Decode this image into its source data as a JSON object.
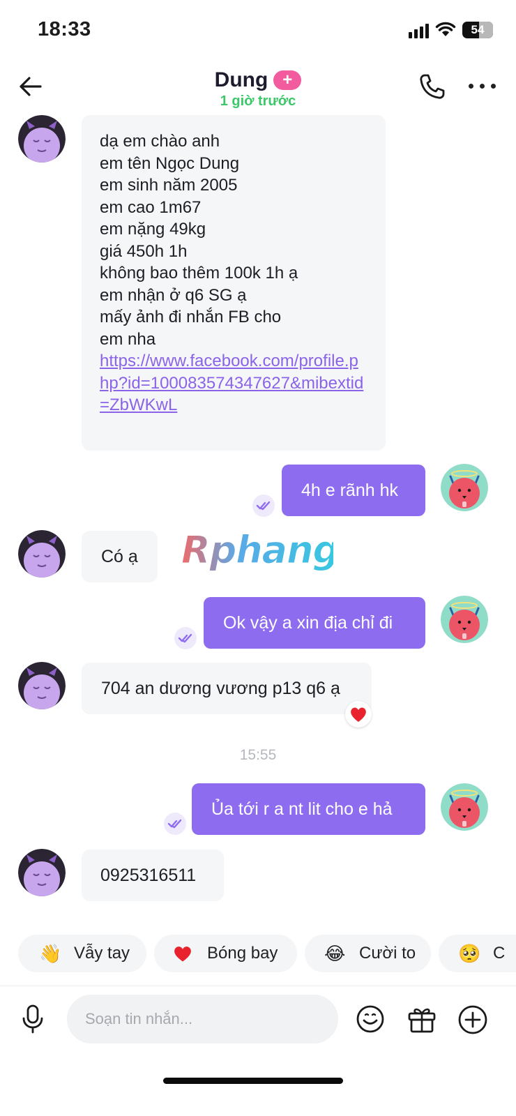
{
  "status_bar": {
    "time": "18:33",
    "battery": "54",
    "battery_level": 0.54
  },
  "header": {
    "contact_name": "Dung",
    "plus_badge": "+",
    "last_seen": "1 giờ trước"
  },
  "messages": {
    "m1": {
      "lines": [
        "dạ em chào anh",
        "em tên Ngọc Dung",
        "em sinh năm 2005",
        "em cao 1m67",
        "em nặng 49kg",
        "giá 450h 1h",
        "không bao thêm 100k 1h ạ",
        "em nhận ở q6 SG ạ",
        "mấy ảnh đi nhắn FB cho",
        "em nha"
      ],
      "link": "https://www.facebook.com/profile.php?id=100083574347627&mibextid=ZbWKwL"
    },
    "m2": {
      "text": "4h e rãnh hk"
    },
    "m3": {
      "text": "Có ạ"
    },
    "m4": {
      "text": "Ok vậy a xin địa chỉ đi"
    },
    "m5": {
      "text": "704 an dương vương p13 q6 ạ",
      "reaction": "❤️"
    },
    "time_sep": "15:55",
    "m6": {
      "text": "Ủa tới r a nt lit cho e hả"
    },
    "m7": {
      "text": "0925316511"
    }
  },
  "watermark": "Rphang",
  "quick_reactions": [
    {
      "emoji": "👋",
      "label": "Vẫy tay"
    },
    {
      "emoji": "❤️",
      "label": "Bóng bay"
    },
    {
      "emoji": "😂",
      "label": "Cười to"
    },
    {
      "emoji": "🥺",
      "label": "C"
    }
  ],
  "composer": {
    "placeholder": "Soạn tin nhắn..."
  },
  "colors": {
    "accent": "#8e6cf0",
    "online": "#3bc76a",
    "badge": "#f25c9e",
    "link": "#8a63e8"
  }
}
